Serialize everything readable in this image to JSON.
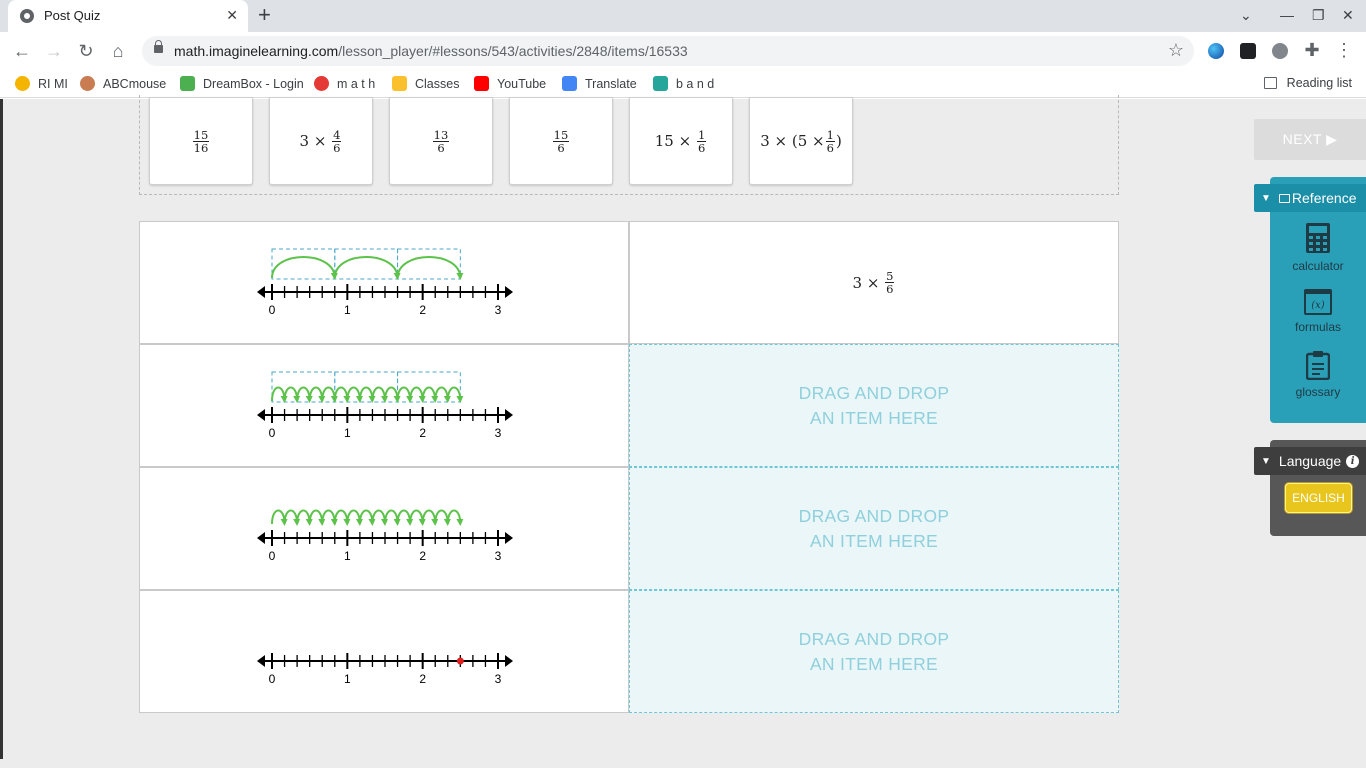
{
  "browser": {
    "tab_title": "Post Quiz",
    "new_tab": "+",
    "url_host": "math.imaginelearning.com",
    "url_path": "/lesson_player/#lessons/543/activities/2848/items/16533",
    "bookmarks": [
      "RI MI",
      "ABCmouse",
      "DreamBox - Login",
      "m a t h",
      "Classes",
      "YouTube",
      "Translate",
      "b a n d"
    ],
    "reading_list": "Reading list"
  },
  "tray": {
    "cards": [
      {
        "type": "fraction",
        "num": "15",
        "den": "16"
      },
      {
        "type": "times_fraction",
        "whole": "3",
        "num": "4",
        "den": "6"
      },
      {
        "type": "fraction",
        "num": "13",
        "den": "6"
      },
      {
        "type": "fraction",
        "num": "15",
        "den": "6"
      },
      {
        "type": "times_fraction",
        "whole": "15",
        "num": "1",
        "den": "6"
      },
      {
        "type": "nested",
        "whole": "3",
        "inner_whole": "5",
        "num": "1",
        "den": "6"
      }
    ]
  },
  "rows": [
    {
      "answer": {
        "whole": "3",
        "num": "5",
        "den": "6"
      },
      "number_line": {
        "ticks": [
          "0",
          "1",
          "2",
          "3"
        ],
        "jumps": 3,
        "jump_size_sixths": 5,
        "boxed": true
      }
    },
    {
      "drop_line1": "DRAG AND DROP",
      "drop_line2": "AN ITEM HERE",
      "number_line": {
        "ticks": [
          "0",
          "1",
          "2",
          "3"
        ],
        "jumps": 15,
        "jump_size_sixths": 1,
        "boxed": true,
        "box_groups": 3
      }
    },
    {
      "drop_line1": "DRAG AND DROP",
      "drop_line2": "AN ITEM HERE",
      "number_line": {
        "ticks": [
          "0",
          "1",
          "2",
          "3"
        ],
        "jumps": 15,
        "jump_size_sixths": 1,
        "boxed": false
      }
    },
    {
      "drop_line1": "DRAG AND DROP",
      "drop_line2": "AN ITEM HERE",
      "number_line": {
        "ticks": [
          "0",
          "1",
          "2",
          "3"
        ],
        "jumps": 0,
        "point_sixths": 15
      }
    }
  ],
  "sidebar": {
    "next_label": "NEXT ▶",
    "reference_label": "Reference",
    "tools": [
      "calculator",
      "formulas",
      "glossary"
    ],
    "language_label": "Language",
    "english_label": "ENGLISH"
  },
  "colors": {
    "jump_arc": "#5cc24a",
    "box_dash": "#4aa9c8",
    "point": "#e02020",
    "drop_text": "#8fd0dc",
    "reference_panel": "#2aa0b8"
  }
}
